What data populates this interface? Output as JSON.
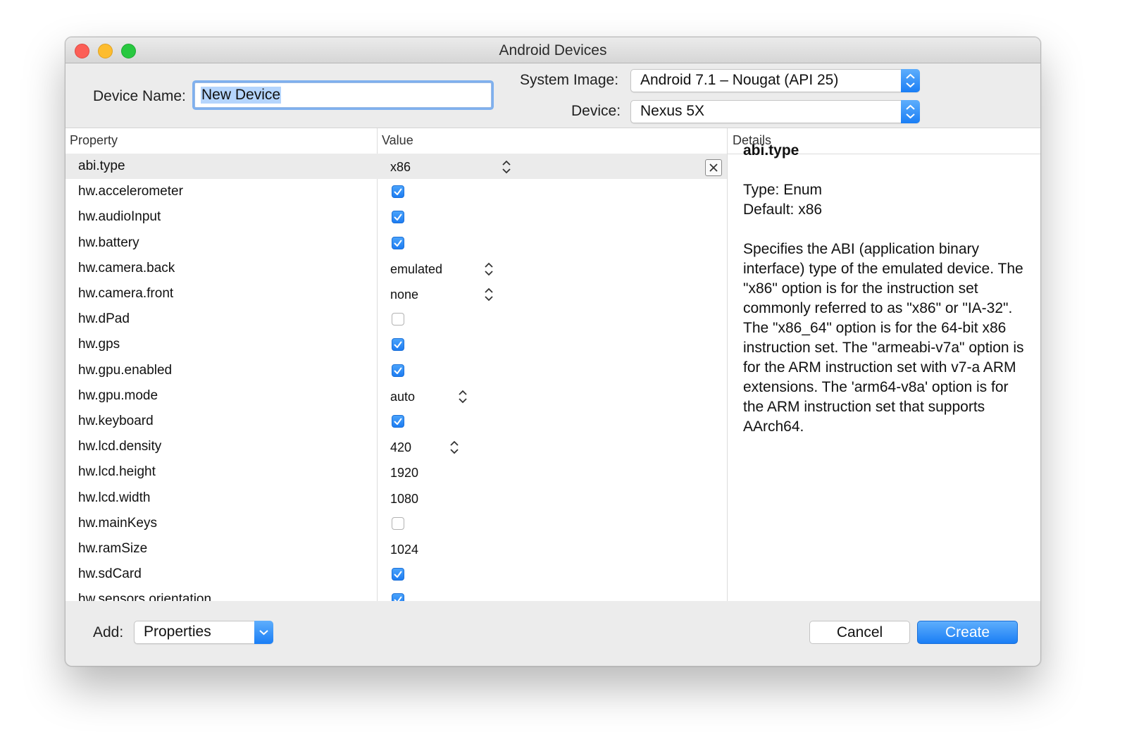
{
  "window": {
    "title": "Android Devices"
  },
  "form": {
    "device_name_label": "Device Name:",
    "device_name_value": "New Device",
    "system_image_label": "System Image:",
    "system_image_value": "Android 7.1 – Nougat (API 25)",
    "device_label": "Device:",
    "device_value": "Nexus 5X"
  },
  "table": {
    "headers": {
      "property": "Property",
      "value": "Value",
      "details": "Details"
    },
    "rows": [
      {
        "property": "abi.type",
        "kind": "enum",
        "value": "x86",
        "selected": true
      },
      {
        "property": "hw.accelerometer",
        "kind": "bool",
        "checked": true
      },
      {
        "property": "hw.audioInput",
        "kind": "bool",
        "checked": true
      },
      {
        "property": "hw.battery",
        "kind": "bool",
        "checked": true
      },
      {
        "property": "hw.camera.back",
        "kind": "enum",
        "value": "emulated"
      },
      {
        "property": "hw.camera.front",
        "kind": "enum",
        "value": "none"
      },
      {
        "property": "hw.dPad",
        "kind": "bool",
        "checked": false
      },
      {
        "property": "hw.gps",
        "kind": "bool",
        "checked": true
      },
      {
        "property": "hw.gpu.enabled",
        "kind": "bool",
        "checked": true
      },
      {
        "property": "hw.gpu.mode",
        "kind": "enum",
        "value": "auto"
      },
      {
        "property": "hw.keyboard",
        "kind": "bool",
        "checked": true
      },
      {
        "property": "hw.lcd.density",
        "kind": "enum",
        "value": "420"
      },
      {
        "property": "hw.lcd.height",
        "kind": "text",
        "value": "1920"
      },
      {
        "property": "hw.lcd.width",
        "kind": "text",
        "value": "1080"
      },
      {
        "property": "hw.mainKeys",
        "kind": "bool",
        "checked": false
      },
      {
        "property": "hw.ramSize",
        "kind": "text",
        "value": "1024"
      },
      {
        "property": "hw.sdCard",
        "kind": "bool",
        "checked": true
      },
      {
        "property": "hw.sensors.orientation",
        "kind": "bool",
        "checked": true
      }
    ]
  },
  "details": {
    "title": "abi.type",
    "type_line": "Type: Enum",
    "default_line": "Default: x86",
    "description": "Specifies the ABI (application binary interface) type of the emulated device. The \"x86\" option is for the instruction set commonly referred to as \"x86\" or \"IA-32\". The \"x86_64\" option is for the 64-bit x86 instruction set. The \"armeabi-v7a\" option is for the ARM instruction set with v7-a ARM extensions. The 'arm64-v8a' option is for the ARM instruction set that supports AArch64."
  },
  "footer": {
    "add_label": "Add:",
    "add_value": "Properties",
    "cancel_label": "Cancel",
    "create_label": "Create"
  },
  "colors": {
    "accent": "#1a7ef5",
    "selection": "#b5d5fd",
    "row_selected": "#ebebeb"
  },
  "icons": {
    "stepper": "chevron-up-down-icon",
    "clear": "close-icon",
    "popup": "chevron-down-icon"
  }
}
